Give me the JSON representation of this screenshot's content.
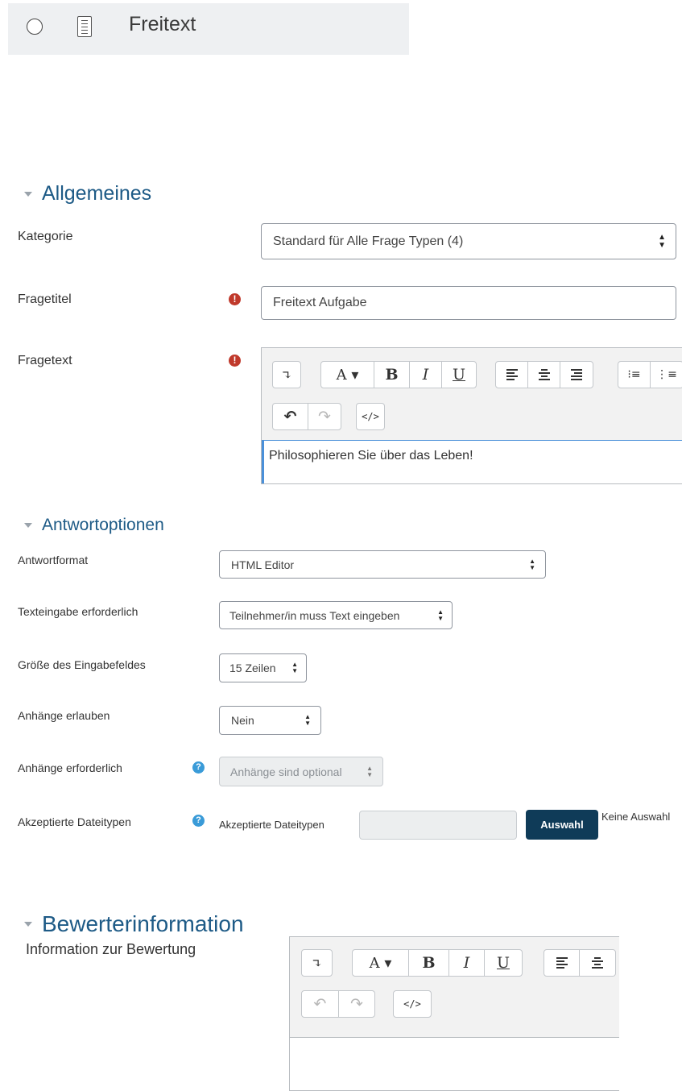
{
  "question_type": {
    "label": "Freitext"
  },
  "general": {
    "title": "Allgemeines",
    "category": {
      "label": "Kategorie",
      "value": "Standard für Alle Frage Typen (4)"
    },
    "question_name": {
      "label": "Fragetitel",
      "value": "Freitext Aufgabe"
    },
    "question_text": {
      "label": "Fragetext",
      "content": "Philosophieren Sie über das Leben!"
    }
  },
  "response_options": {
    "title": "Antwortoptionen",
    "response_format": {
      "label": "Antwortformat",
      "value": "HTML Editor"
    },
    "response_required": {
      "label": "Texteingabe erforderlich",
      "value": "Teilnehmer/in muss Text eingeben"
    },
    "field_lines": {
      "label": "Größe des Eingabefeldes",
      "value": "15 Zeilen"
    },
    "attachments": {
      "label": "Anhänge erlauben",
      "value": "Nein"
    },
    "attachments_required": {
      "label": "Anhänge erforderlich",
      "value": "Anhänge sind optional"
    },
    "filetypes": {
      "label": "Akzeptierte Dateitypen",
      "inner_label": "Akzeptierte Dateitypen",
      "value": "",
      "button": "Auswahl",
      "status": "Keine Auswahl"
    }
  },
  "grader_info": {
    "title": "Bewerterinformation",
    "label": "Information zur Bewertung",
    "content": ""
  },
  "toolbar": {
    "more": "↴",
    "font": "A ▾",
    "bold": "B",
    "italic": "I",
    "underline": "U",
    "undo": "↶",
    "redo": "↷",
    "html": "</>"
  },
  "colors": {
    "section_title": "#1d5a86",
    "required_icon": "#c0392b",
    "help_icon": "#3a9bd8",
    "primary_button": "#0f3b58",
    "editor_focus": "#4a90d9"
  }
}
